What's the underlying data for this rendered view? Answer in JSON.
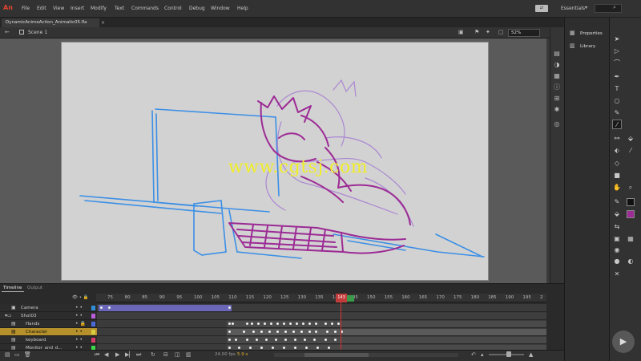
{
  "app": {
    "logo": "An"
  },
  "menu": [
    "File",
    "Edit",
    "View",
    "Insert",
    "Modify",
    "Text",
    "Commands",
    "Control",
    "Debug",
    "Window",
    "Help"
  ],
  "workspace": {
    "label": "Essentials"
  },
  "document": {
    "tab_title": "DynamicAnimeAction_Animatic05.fla",
    "scene": "Scene 1",
    "zoom": "52%"
  },
  "watermark": "www.cgtsj.com",
  "panels": {
    "properties": "Properties",
    "library": "Library"
  },
  "timeline": {
    "tabs": [
      "Timeline",
      "Output"
    ],
    "frame_numbers": [
      "75",
      "80",
      "85",
      "90",
      "95",
      "100",
      "105",
      "110",
      "115",
      "120",
      "125",
      "130",
      "135",
      "14",
      "145",
      "150",
      "155",
      "160",
      "165",
      "170",
      "175",
      "180",
      "185",
      "190",
      "195",
      "2"
    ],
    "current_frame": "143",
    "fps": "24.00 fps",
    "time": "5.9 s",
    "layers": [
      {
        "name": "Camera",
        "type": "camera",
        "color": "#2f8fd8",
        "selected": false
      },
      {
        "name": "Shot03",
        "type": "folder",
        "color": "#b95dd8",
        "selected": false
      },
      {
        "name": "Hands",
        "type": "layer",
        "color": "#4a6ad8",
        "selected": false
      },
      {
        "name": "Character",
        "type": "layer",
        "color": "#d8d040",
        "selected": true
      },
      {
        "name": "keyboard",
        "type": "layer",
        "color": "#d83a6a",
        "selected": false
      },
      {
        "name": "Monitor_and_d...",
        "type": "layer",
        "color": "#3ad84a",
        "selected": false
      }
    ]
  },
  "colors": {
    "stroke": "#111111",
    "fill": "#9c2b95",
    "accent": "#b6902a"
  }
}
